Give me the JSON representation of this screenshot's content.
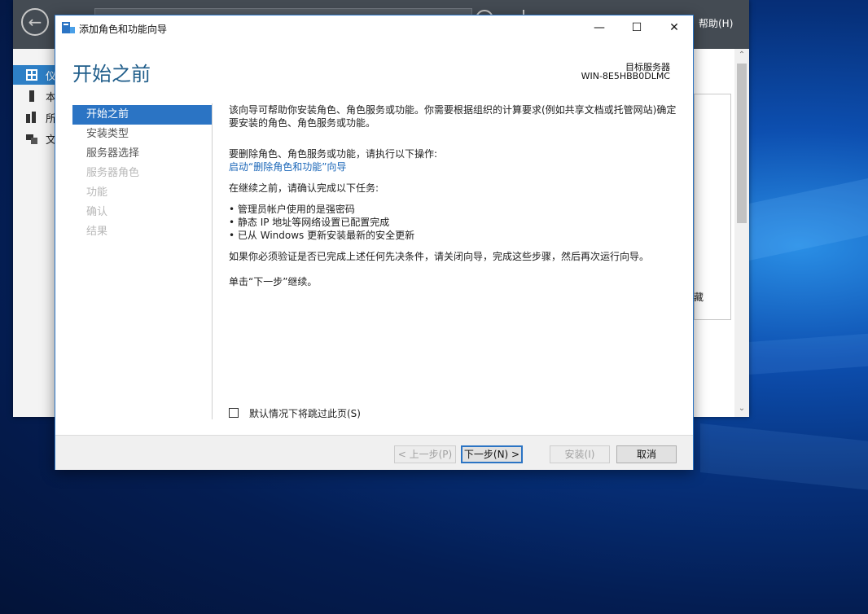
{
  "server_manager": {
    "help_menu": "帮助(H)",
    "nav": [
      {
        "icon": "dashboard-icon",
        "label": "仪",
        "active": true
      },
      {
        "icon": "local-server-icon",
        "label": "本",
        "active": false
      },
      {
        "icon": "all-servers-icon",
        "label": "所",
        "active": false
      },
      {
        "icon": "file-services-icon",
        "label": "文",
        "active": false
      }
    ],
    "panel_fragment": "藏"
  },
  "wizard": {
    "title": "添加角色和功能向导",
    "heading": "开始之前",
    "destination_label": "目标服务器",
    "destination_server": "WIN-8E5HBB0DLMC",
    "steps": [
      {
        "label": "开始之前",
        "state": "active"
      },
      {
        "label": "安装类型",
        "state": "normal"
      },
      {
        "label": "服务器选择",
        "state": "normal"
      },
      {
        "label": "服务器角色",
        "state": "disabled"
      },
      {
        "label": "功能",
        "state": "disabled"
      },
      {
        "label": "确认",
        "state": "disabled"
      },
      {
        "label": "结果",
        "state": "disabled"
      }
    ],
    "content": {
      "intro_line1": "该向导可帮助你安装角色、角色服务或功能。你需要根据组织的计算要求(例如共享文档或托管网站)确定",
      "intro_line2": "要安装的角色、角色服务或功能。",
      "remove_intro": "要删除角色、角色服务或功能，请执行以下操作:",
      "remove_link": "启动“删除角色和功能”向导",
      "before_continue": "在继续之前，请确认完成以下任务:",
      "tasks": [
        "管理员帐户使用的是强密码",
        "静态 IP 地址等网络设置已配置完成",
        "已从 Windows 更新安装最新的安全更新"
      ],
      "verify_text": "如果你必须验证是否已完成上述任何先决条件，请关闭向导，完成这些步骤，然后再次运行向导。",
      "continue_text": "单击“下一步”继续。"
    },
    "skip_checkbox_label": "默认情况下将跳过此页(S)",
    "skip_checked": false,
    "buttons": {
      "previous": "< 上一步(P)",
      "next": "下一步(N) >",
      "install": "安装(I)",
      "cancel": "取消"
    },
    "window_controls": {
      "minimize": "—",
      "maximize": "☐",
      "close": "✕"
    }
  }
}
